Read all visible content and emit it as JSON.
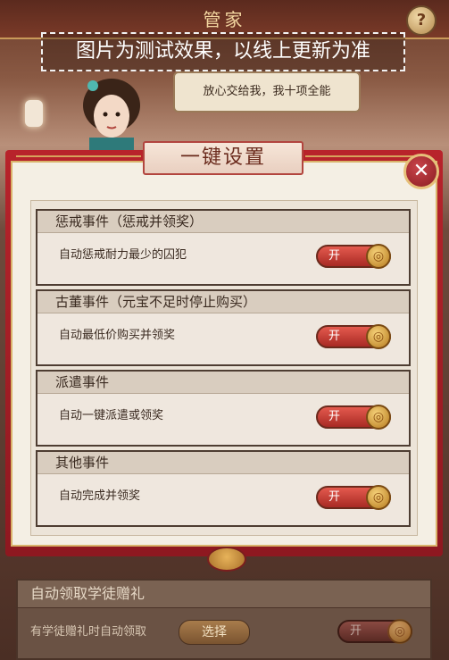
{
  "header": {
    "title": "管家",
    "help_icon": "?"
  },
  "notice": "图片为测试效果，以线上更新为准",
  "speech": "放心交给我，我十项全能",
  "dialog": {
    "title": "一键设置",
    "close_icon": "✕",
    "sections": [
      {
        "title": "惩戒事件（惩戒并领奖）",
        "desc": "自动惩戒耐力最少的囚犯",
        "toggle": "开"
      },
      {
        "title": "古董事件（元宝不足时停止购买）",
        "desc": "自动最低价购买并领奖",
        "toggle": "开"
      },
      {
        "title": "派遣事件",
        "desc": "自动一键派遣或领奖",
        "toggle": "开"
      },
      {
        "title": "其他事件",
        "desc": "自动完成并领奖",
        "toggle": "开"
      }
    ]
  },
  "background_panel": {
    "title": "自动领取学徒赠礼",
    "desc": "有学徒赠礼时自动领取",
    "choose_label": "选择",
    "toggle": "开"
  },
  "colors": {
    "dialog_red": "#b8232b",
    "gold": "#d9b36a",
    "toggle_red": "#e45a4e"
  }
}
